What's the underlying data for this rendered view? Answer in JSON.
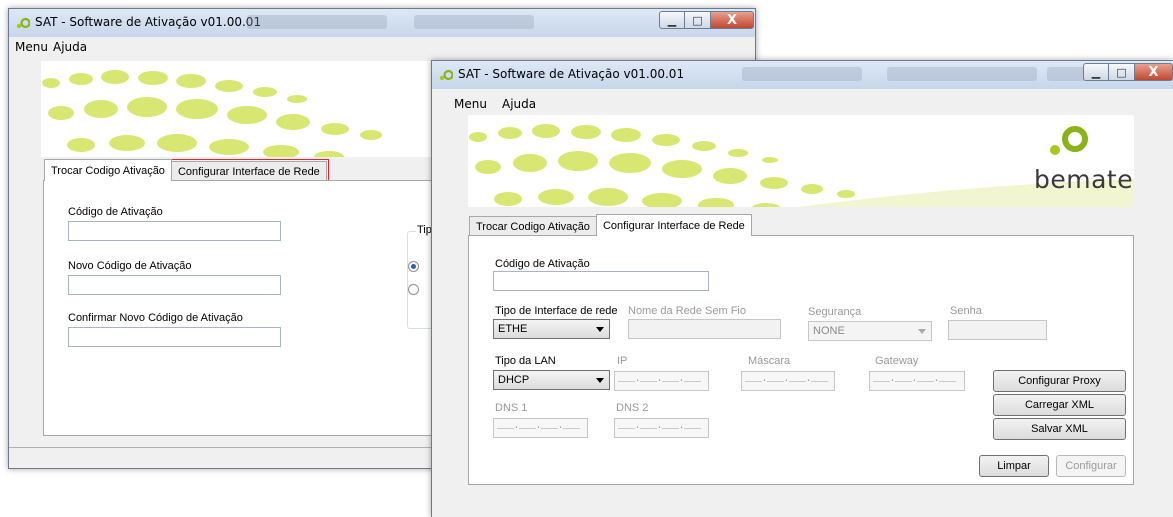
{
  "app": {
    "title": "SAT - Software de Ativação v01.00.01"
  },
  "menu": {
    "items": [
      "Menu",
      "Ajuda"
    ]
  },
  "window_controls": {
    "minimize": "▁",
    "maximize": "□",
    "close": "X"
  },
  "brand": {
    "logo_text": "bematech"
  },
  "tabs": {
    "trocar": "Trocar Codigo Ativação",
    "configurar": "Configurar Interface de Rede"
  },
  "back": {
    "codigo_label": "Código de Ativação",
    "novo_label": "Novo Código de Ativação",
    "confirmar_label": "Confirmar Novo Código de Ativação",
    "tipo_partial": "Tipo",
    "radio_selected_index": 0
  },
  "front": {
    "codigo_label": "Código de Ativação",
    "tipo_interface_label": "Tipo de Interface de rede",
    "tipo_interface_value": "ETHE",
    "nome_rede_label": "Nome da Rede Sem Fio",
    "seguranca_label": "Segurança",
    "seguranca_value": "NONE",
    "senha_label": "Senha",
    "tipo_lan_label": "Tipo da LAN",
    "tipo_lan_value": "DHCP",
    "ip_label": "IP",
    "mascara_label": "Máscara",
    "gateway_label": "Gateway",
    "dns1_label": "DNS 1",
    "dns2_label": "DNS 2",
    "ip_mask": "___.___.___.___",
    "buttons": {
      "proxy": "Configurar Proxy",
      "carregar": "Carregar XML",
      "salvar": "Salvar XML",
      "limpar": "Limpar",
      "configurar": "Configurar"
    }
  },
  "colors": {
    "title_bar": "#c7d6ea",
    "close_button": "#c2472e",
    "highlight": "#e0262a",
    "brand_green": "#a8c81e",
    "dots_light": "#d9e86a"
  }
}
